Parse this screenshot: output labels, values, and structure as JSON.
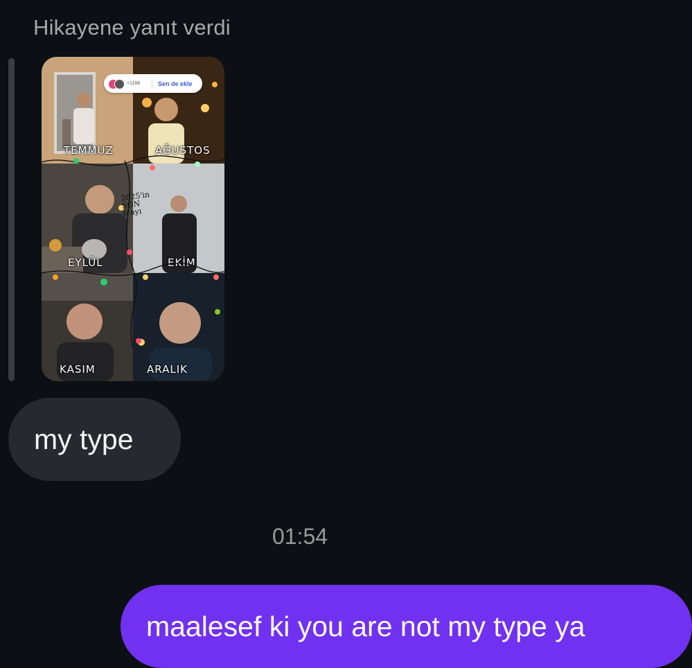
{
  "reply": {
    "header": "Hikayene yanıt verdi"
  },
  "story": {
    "viewers_count": "+1168",
    "add_yours_label": "Sen de ekle",
    "handwritten_lines": [
      "2025'in",
      "SON",
      "6 ayı"
    ],
    "cells": [
      {
        "label": "TEMMUZ"
      },
      {
        "label": "AĞUSTOS"
      },
      {
        "label": "EYLÜL"
      },
      {
        "label": "EKİM"
      },
      {
        "label": "KASIM"
      },
      {
        "label": "ARALIK"
      }
    ]
  },
  "messages": {
    "incoming_text": "my type",
    "timestamp": "01:54",
    "outgoing_text": "maalesef ki you are not my type ya"
  },
  "colors": {
    "background": "#0c1014",
    "incoming_bubble": "#262a2f",
    "outgoing_bubble": "#7131f0",
    "secondary_text": "#a8a8a8"
  }
}
